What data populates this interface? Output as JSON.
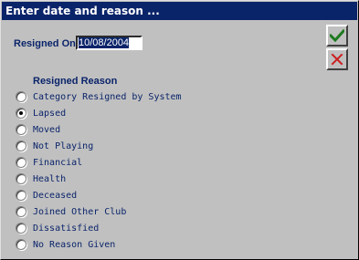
{
  "window": {
    "title": "Enter date and reason ..."
  },
  "resigned": {
    "label": "Resigned On",
    "value": "10/08/2004"
  },
  "buttons": {
    "ok_icon": "check-icon",
    "cancel_icon": "x-icon",
    "ok_color": "#1e7a1e",
    "cancel_color": "#cc2020"
  },
  "reason": {
    "group_label": "Resigned Reason",
    "selected_index": 1,
    "options": [
      "Category Resigned by System",
      "Lapsed",
      "Moved",
      "Not Playing",
      "Financial",
      "Health",
      "Deceased",
      "Joined Other Club",
      "Dissatisfied",
      "No Reason Given"
    ]
  }
}
